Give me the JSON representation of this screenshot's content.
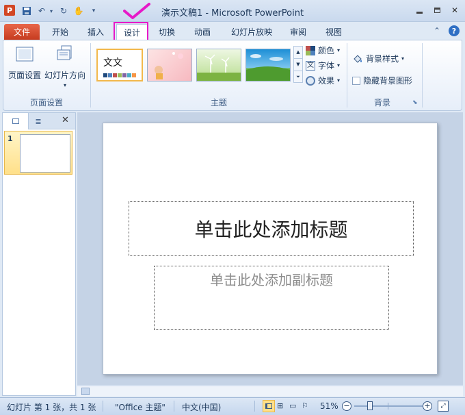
{
  "window": {
    "title": "演示文稿1 - Microsoft PowerPoint",
    "app_icon": "P",
    "controls": {
      "minimize": "▭",
      "restore": "▢",
      "close": "✕"
    }
  },
  "tabs": [
    {
      "label": "文件"
    },
    {
      "label": "开始"
    },
    {
      "label": "插入"
    },
    {
      "label": "设计"
    },
    {
      "label": "切换"
    },
    {
      "label": "动画"
    },
    {
      "label": "幻灯片放映"
    },
    {
      "label": "审阅"
    },
    {
      "label": "视图"
    }
  ],
  "ribbon": {
    "page_setup_group": {
      "page_setup": "页面设置",
      "orientation": "幻灯片方向",
      "label": "页面设置"
    },
    "themes_group": {
      "first_theme_text": "文文",
      "colors": "颜色",
      "fonts": "字体",
      "effects": "效果",
      "label": "主题"
    },
    "background_group": {
      "bg_styles": "背景样式",
      "hide_bg": "隐藏背景图形",
      "label": "背景"
    },
    "colors": {
      "accent_bg": "#dfe9f5",
      "mark": "#e619c8"
    }
  },
  "panel": {
    "slide_number": "1"
  },
  "slide": {
    "title_placeholder": "单击此处添加标题",
    "subtitle_placeholder": "单击此处添加副标题"
  },
  "status": {
    "slide_info": "幻灯片 第 1 张，共 1 张",
    "theme": "\"Office 主题\"",
    "language": "中文(中国)",
    "zoom": "51%",
    "zoom_fraction": 0.51
  }
}
